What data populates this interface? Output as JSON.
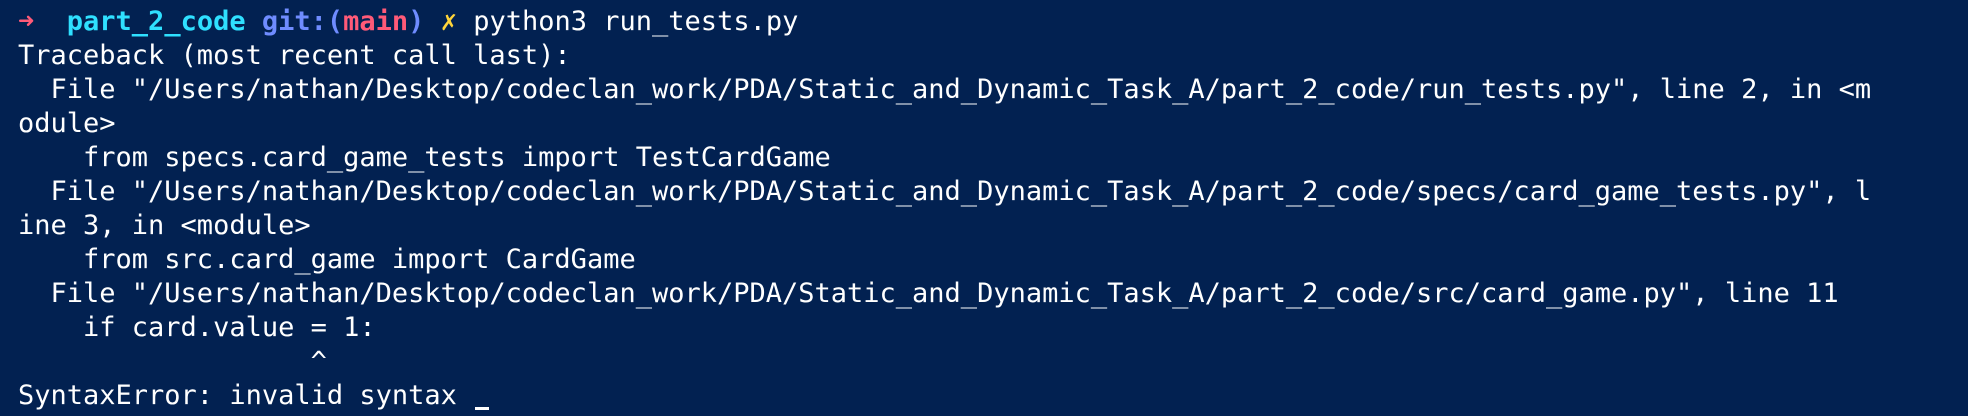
{
  "prompt": {
    "arrow": "➜",
    "directory": "part_2_code",
    "git_label": "git:(",
    "branch": "main",
    "git_close": ")",
    "dirty_marker": "✗",
    "command": "python3 run_tests.py"
  },
  "output": [
    "Traceback (most recent call last):",
    "  File \"/Users/nathan/Desktop/codeclan_work/PDA/Static_and_Dynamic_Task_A/part_2_code/run_tests.py\", line 2, in <m",
    "odule>",
    "    from specs.card_game_tests import TestCardGame",
    "  File \"/Users/nathan/Desktop/codeclan_work/PDA/Static_and_Dynamic_Task_A/part_2_code/specs/card_game_tests.py\", l",
    "ine 3, in <module>",
    "    from src.card_game import CardGame",
    "  File \"/Users/nathan/Desktop/codeclan_work/PDA/Static_and_Dynamic_Task_A/part_2_code/src/card_game.py\", line 11",
    "    if card.value = 1:",
    "                  ^",
    "SyntaxError: invalid syntax "
  ],
  "colors": {
    "background": "#022151",
    "text": "#ffffff",
    "prompt_arrow": "#ff5a78",
    "directory": "#2fe0ff",
    "git": "#6f8cff",
    "branch": "#ff5a78",
    "dirty": "#ffd43a"
  }
}
